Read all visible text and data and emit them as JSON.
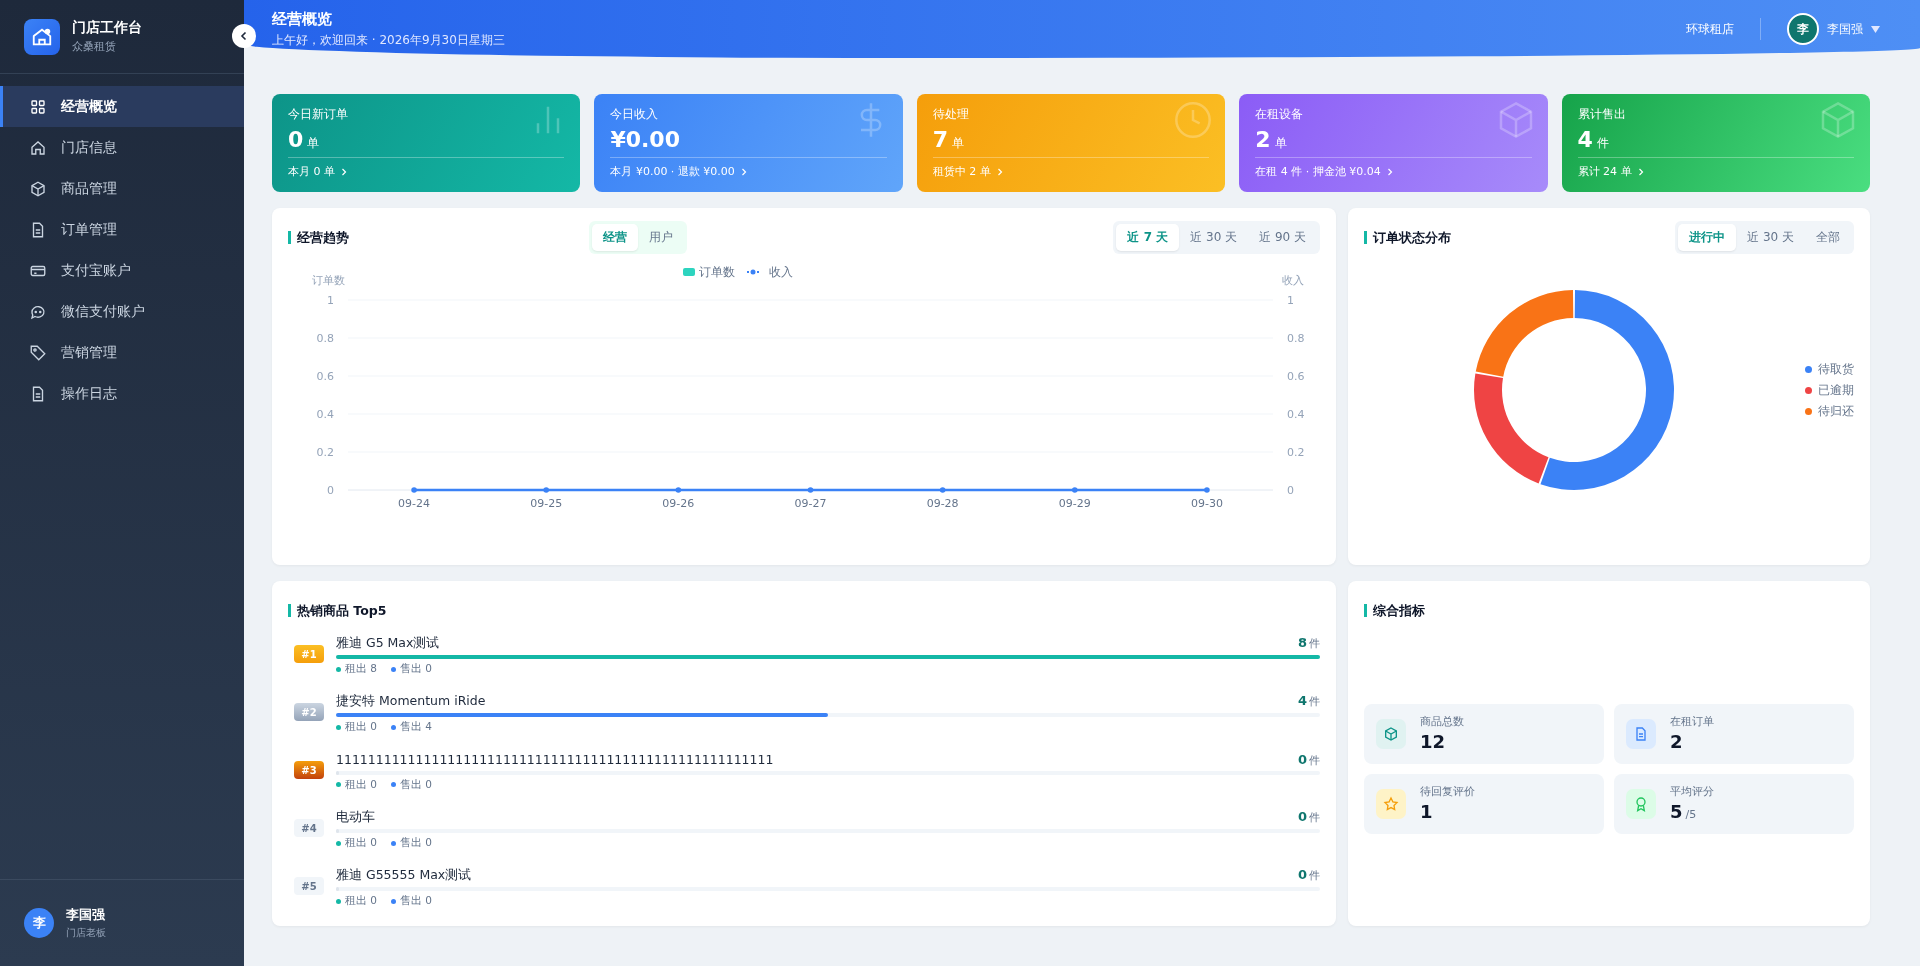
{
  "sidebar": {
    "title": "门店工作台",
    "subtitle": "众桑租赁",
    "items": [
      {
        "label": "经营概览",
        "kind": "grid",
        "selected": true
      },
      {
        "label": "门店信息",
        "kind": "home",
        "selected": false
      },
      {
        "label": "商品管理",
        "kind": "box",
        "selected": false
      },
      {
        "label": "订单管理",
        "kind": "doc",
        "selected": false
      },
      {
        "label": "支付宝账户",
        "kind": "card",
        "selected": false
      },
      {
        "label": "微信支付账户",
        "kind": "chat",
        "selected": false
      },
      {
        "label": "营销管理",
        "kind": "tag",
        "selected": false
      },
      {
        "label": "操作日志",
        "kind": "doc",
        "selected": false
      }
    ],
    "user": {
      "avatar": "李",
      "name": "李国强",
      "role": "门店老板"
    }
  },
  "header": {
    "title": "经营概览",
    "subtitle": "上午好，欢迎回来 · 2026年9月30日星期三",
    "store": "环球租店",
    "avatar": "李",
    "user": "李国强"
  },
  "kpis": [
    {
      "kind": "orders",
      "label": "今日新订单",
      "value": "0",
      "unit": "单",
      "footer": "本月 0 单"
    },
    {
      "kind": "income",
      "label": "今日收入",
      "value": "¥0.00",
      "footer": "本月 ¥0.00 · 退款 ¥0.00"
    },
    {
      "kind": "pending",
      "label": "待处理",
      "value": "7",
      "unit": "单",
      "footer": "租赁中 2 单"
    },
    {
      "kind": "rental",
      "label": "在租设备",
      "value": "2",
      "unit": "单",
      "footer": "在租 4 件 · 押金池 ¥0.04"
    },
    {
      "kind": "sold",
      "label": "累计售出",
      "value": "4",
      "unit": "件",
      "footer": "累计 24 单"
    }
  ],
  "trend": {
    "title": "经营趋势",
    "modes": [
      {
        "label": "经营",
        "selected": true
      },
      {
        "label": "用户",
        "selected": false
      }
    ],
    "periods": [
      {
        "label": "近 7 天",
        "selected": true
      },
      {
        "label": "近 30 天",
        "selected": false
      },
      {
        "label": "近 90 天",
        "selected": false
      }
    ],
    "chart_data": {
      "type": "line",
      "ylabel": "订单数",
      "y2label": "收入",
      "categories": [
        "09-24",
        "09-25",
        "09-26",
        "09-27",
        "09-28",
        "09-29",
        "09-30"
      ],
      "series": [
        {
          "name": "订单数",
          "type": "bar",
          "color": "#2dd4bf",
          "values": [
            0,
            0,
            0,
            0,
            0,
            0,
            0
          ]
        },
        {
          "name": "收入",
          "color": "#3b82f6",
          "values": [
            0,
            0,
            0,
            0,
            0,
            0,
            0
          ]
        }
      ],
      "ylim": [
        0,
        1
      ],
      "yticks": [
        0,
        0.2,
        0.4,
        0.6,
        0.8,
        1
      ],
      "y2lim": [
        0,
        1
      ],
      "y2ticks": [
        0,
        0.2,
        0.4,
        0.6,
        0.8,
        1
      ],
      "grid": true,
      "legend": true
    }
  },
  "status": {
    "title": "订单状态分布",
    "periods": [
      {
        "label": "进行中",
        "selected": true
      },
      {
        "label": "近 30 天",
        "selected": false
      },
      {
        "label": "全部",
        "selected": false
      }
    ],
    "chart_data": {
      "type": "donut",
      "categories": [
        "待取货",
        "已逾期",
        "待归还"
      ],
      "values": [
        55.6,
        22.2,
        22.2
      ],
      "colors": [
        "#3b82f6",
        "#ef4444",
        "#f97316"
      ],
      "legend": true
    }
  },
  "top": {
    "title": "热销商品 Top5",
    "items": [
      {
        "rank": "#1",
        "kind": "gold",
        "name": "雅迪 G5 Max测试",
        "count": "8",
        "unit": "件",
        "level": 1,
        "color": "#14b8a6",
        "rent": "租出 8",
        "sold": "售出 0"
      },
      {
        "rank": "#2",
        "kind": "silver",
        "name": "捷安特 Momentum iRide",
        "count": "4",
        "unit": "件",
        "level": 0.5,
        "color": "#3b82f6",
        "rent": "租出 0",
        "sold": "售出 4"
      },
      {
        "rank": "#3",
        "kind": "bronze",
        "name": "1111111111111111111111111111111111111111111111111111111",
        "count": "0",
        "unit": "件",
        "level": 0,
        "rent": "租出 0",
        "sold": "售出 0"
      },
      {
        "rank": "#4",
        "kind": "plain",
        "name": "电动车",
        "count": "0",
        "unit": "件",
        "level": 0,
        "rent": "租出 0",
        "sold": "售出 0"
      },
      {
        "rank": "#5",
        "kind": "plain",
        "name": "雅迪 G55555 Max测试",
        "count": "0",
        "unit": "件",
        "level": 0,
        "rent": "租出 0",
        "sold": "售出 0"
      }
    ]
  },
  "metrics": {
    "title": "综合指标",
    "items": [
      {
        "kind": "products",
        "label": "商品总数",
        "value": "12"
      },
      {
        "kind": "orders",
        "label": "在租订单",
        "value": "2"
      },
      {
        "kind": "reviews",
        "label": "待回复评价",
        "value": "1"
      },
      {
        "kind": "rating",
        "label": "平均评分",
        "value": "5",
        "suffix": "/5"
      }
    ]
  }
}
